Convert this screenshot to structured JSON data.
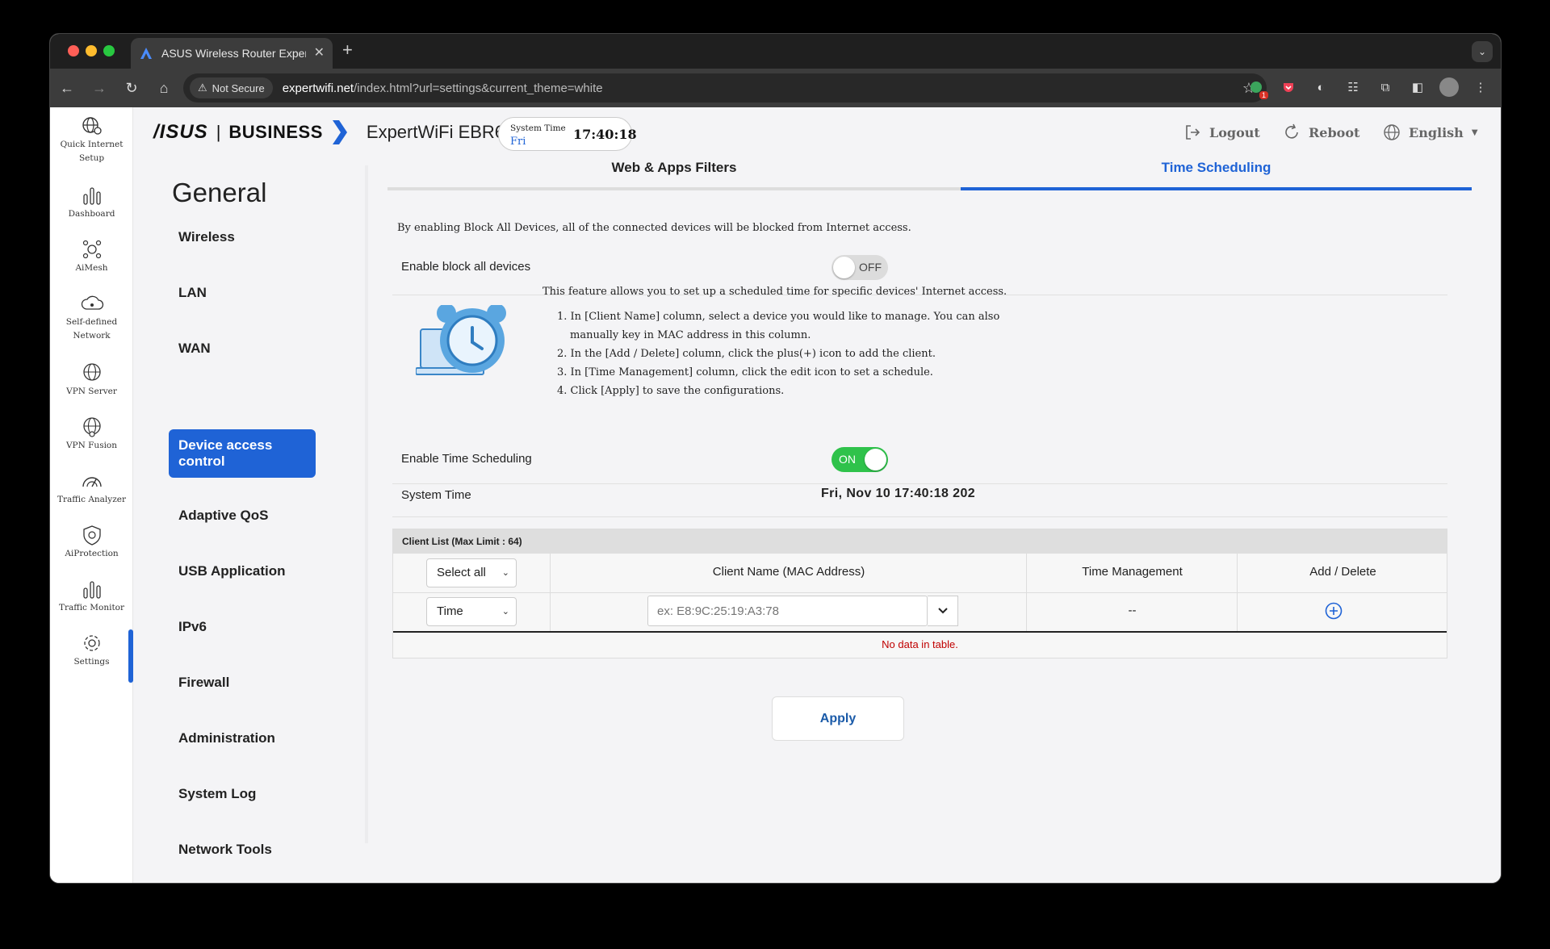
{
  "browser": {
    "tab_title": "ASUS Wireless Router Exper",
    "not_secure_label": "Not Secure",
    "url_host": "expertwifi.net",
    "url_path": "/index.html?url=settings&current_theme=white",
    "extension_badge": "1"
  },
  "header": {
    "brand_logo": "/ISUS",
    "brand_separator": "|",
    "brand_line": "BUSINESS",
    "model": "ExpertWiFi EBR63",
    "system_time_label": "System Time",
    "system_time_day": "Fri",
    "system_time_value": "17:40:18",
    "logout_label": "Logout",
    "reboot_label": "Reboot",
    "language_label": "English"
  },
  "iconbar": {
    "items": [
      {
        "label": "Quick Internet Setup",
        "icon": "globe-gear-icon"
      },
      {
        "label": "Dashboard",
        "icon": "bar-chart-icon"
      },
      {
        "label": "AiMesh",
        "icon": "mesh-icon"
      },
      {
        "label": "Self-defined Network",
        "icon": "cloud-network-icon"
      },
      {
        "label": "VPN Server",
        "icon": "vpn-server-icon"
      },
      {
        "label": "VPN Fusion",
        "icon": "vpn-fusion-icon"
      },
      {
        "label": "Traffic Analyzer",
        "icon": "gauge-icon"
      },
      {
        "label": "AiProtection",
        "icon": "shield-icon"
      },
      {
        "label": "Traffic Monitor",
        "icon": "bar-chart-icon"
      },
      {
        "label": "Settings",
        "icon": "gear-icon"
      }
    ]
  },
  "menu": {
    "title": "General",
    "items": [
      "Wireless",
      "LAN",
      "WAN",
      "Device access control",
      "Adaptive QoS",
      "USB Application",
      "IPv6",
      "Firewall",
      "Administration",
      "System Log",
      "Network Tools"
    ],
    "active": "Device access control"
  },
  "tabs": {
    "web_apps": "Web & Apps Filters",
    "time_scheduling": "Time Scheduling"
  },
  "content": {
    "block_desc": "By enabling Block All Devices, all of the connected devices will be blocked from Internet access.",
    "block_label": "Enable block all devices",
    "block_toggle": "OFF",
    "feature_intro": "This feature allows you to set up a scheduled time for specific devices' Internet access.",
    "steps": [
      "1. In [Client Name] column, select a device you would like to manage. You can also",
      "manually key in MAC address in this column.",
      "2. In the [Add / Delete] column, click the plus(+) icon to add the client.",
      "3. In [Time Management] column, click the edit icon to set a schedule.",
      "4. Click [Apply] to save the configurations."
    ],
    "time_sched_label": "Enable Time Scheduling",
    "time_sched_toggle": "ON",
    "system_time_label": "System Time",
    "system_time_value": "Fri, Nov 10 17:40:18 202"
  },
  "client_table": {
    "title": "Client List (Max Limit : 64)",
    "select_all": "Select all",
    "headers": [
      "Client Name (MAC Address)",
      "Time Management",
      "Add / Delete"
    ],
    "row_mode": "Time",
    "mac_placeholder": "ex: E8:9C:25:19:A3:78",
    "time_mgmt_value": "--",
    "empty_message": "No data in table."
  },
  "apply_label": "Apply",
  "colors": {
    "accent": "#1f63d6",
    "toggle_on": "#2fc24b",
    "error": "#c00000"
  }
}
